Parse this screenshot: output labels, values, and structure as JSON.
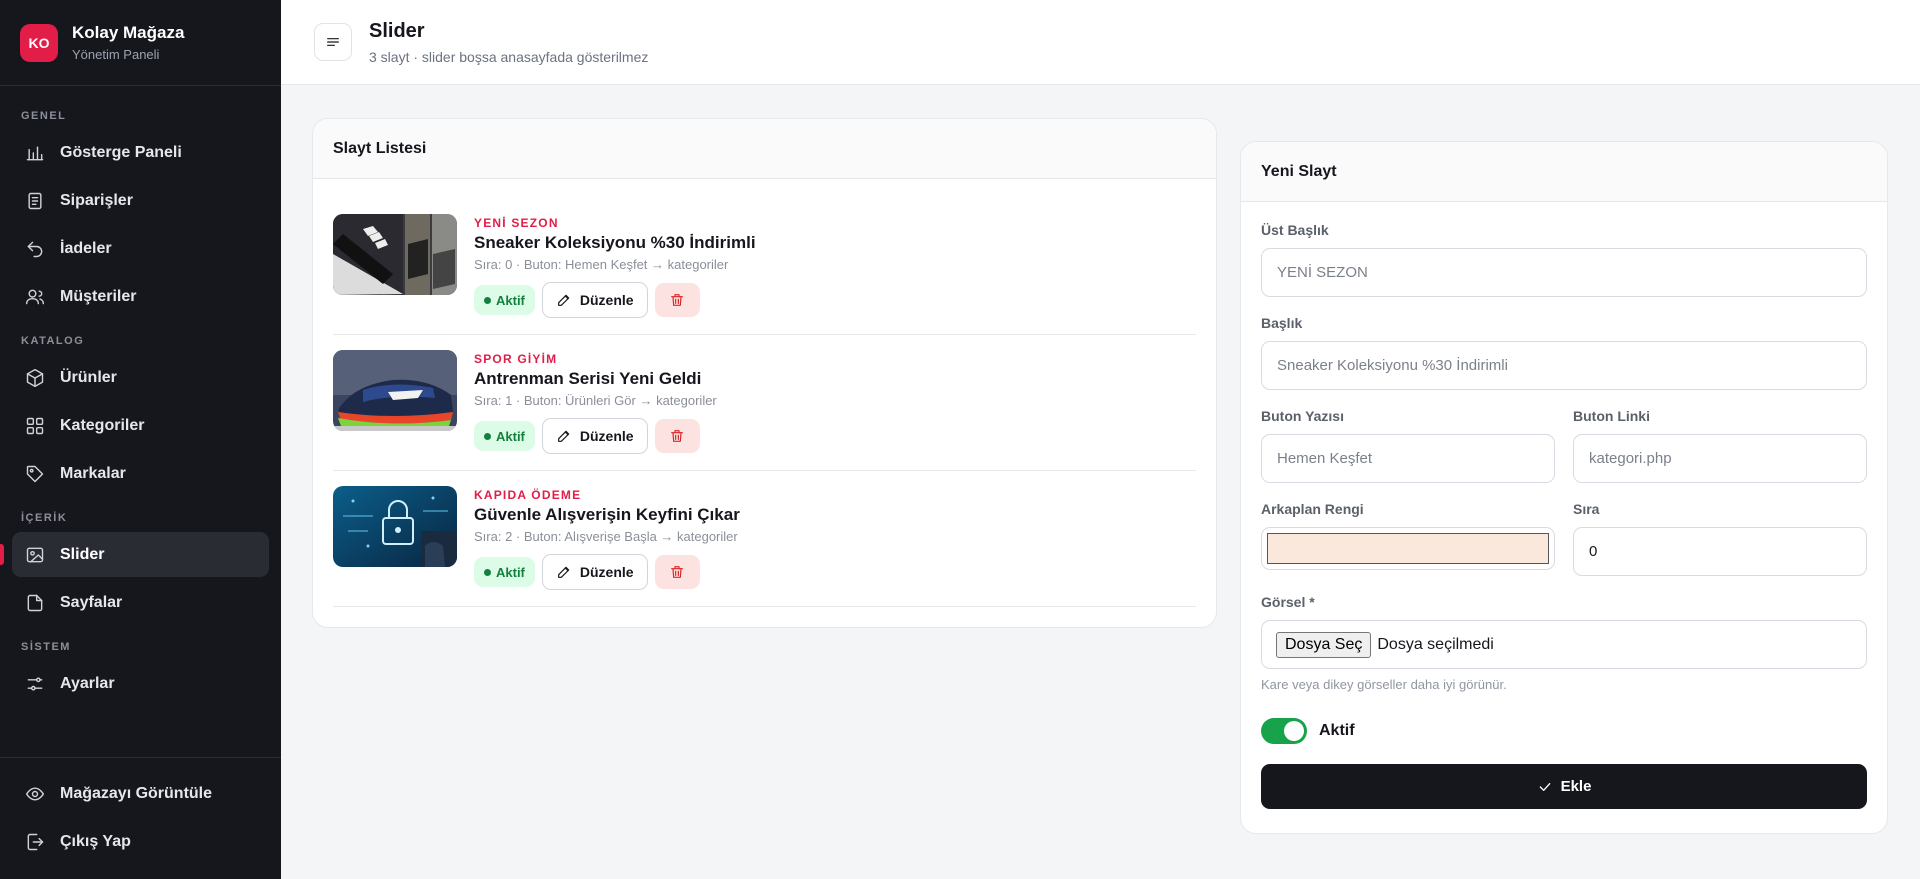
{
  "brand": {
    "initials": "KO",
    "name": "Kolay Mağaza",
    "subtitle": "Yönetim Paneli"
  },
  "nav": {
    "sections": {
      "general": "GENEL",
      "catalog": "KATALOG",
      "content": "İÇERİK",
      "system": "SİSTEM"
    },
    "items": {
      "dashboard": "Gösterge Paneli",
      "orders": "Siparişler",
      "returns": "İadeler",
      "customers": "Müşteriler",
      "products": "Ürünler",
      "categories": "Kategoriler",
      "brands": "Markalar",
      "slider": "Slider",
      "pages": "Sayfalar",
      "settings": "Ayarlar",
      "view_store": "Mağazayı Görüntüle",
      "logout": "Çıkış Yap"
    }
  },
  "header": {
    "title": "Slider",
    "subtitle": "3 slayt · slider boşsa anasayfada gösterilmez"
  },
  "list": {
    "title": "Slayt Listesi",
    "slides": [
      {
        "tag": "YENİ SEZON",
        "title": "Sneaker Koleksiyonu %30 İndirimli",
        "meta": "Sıra: 0 · Buton: Hemen Keşfet → kategoriler",
        "status": "Aktif",
        "edit": "Düzenle"
      },
      {
        "tag": "SPOR GİYİM",
        "title": "Antrenman Serisi Yeni Geldi",
        "meta": "Sıra: 1 · Buton: Ürünleri Gör → kategoriler",
        "status": "Aktif",
        "edit": "Düzenle"
      },
      {
        "tag": "KAPIDA ÖDEME",
        "title": "Güvenle Alışverişin Keyfini Çıkar",
        "meta": "Sıra: 2 · Buton: Alışverişe Başla → kategoriler",
        "status": "Aktif",
        "edit": "Düzenle"
      }
    ]
  },
  "form": {
    "title": "Yeni Slayt",
    "subtitle_label": "Üst Başlık",
    "subtitle_placeholder": "YENİ SEZON",
    "title_label": "Başlık",
    "title_placeholder": "Sneaker Koleksiyonu %30 İndirimli",
    "button_text_label": "Buton Yazısı",
    "button_text_placeholder": "Hemen Keşfet",
    "button_link_label": "Buton Linki",
    "button_link_placeholder": "kategori.php",
    "bg_color_label": "Arkaplan Rengi",
    "bg_color_value": "#fbe8dc",
    "order_label": "Sıra",
    "order_value": "0",
    "image_label": "Görsel *",
    "file_button": "Dosya Seç",
    "file_status": "Dosya seçilmedi",
    "image_hint": "Kare veya dikey görseller daha iyi görünür.",
    "active_label": "Aktif",
    "submit_label": "Ekle"
  },
  "colors": {
    "accent": "#e11d48",
    "sidebar_bg": "#16171d",
    "success": "#15803d"
  }
}
